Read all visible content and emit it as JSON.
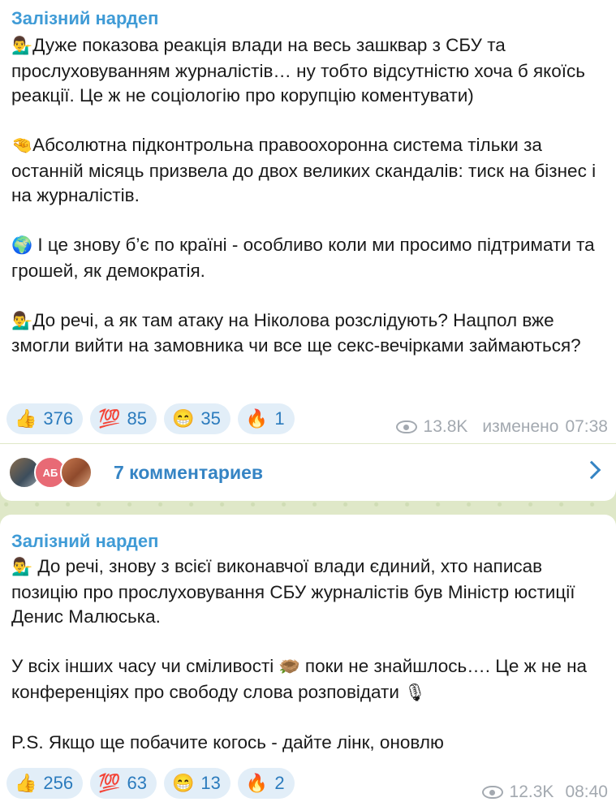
{
  "post1": {
    "sender": "Залізний нардеп",
    "paragraphs": [
      {
        "emoji": "💁‍♂️",
        "text": "Дуже показова реакція влади на весь зашквар з СБУ та прослуховуванням журналістів… ну тобто відсутністю хоча б якоїсь реакції. Це ж не соціологію про корупцію коментувати)"
      },
      {
        "emoji": "🤏",
        "text": "Абсолютна підконтрольна правоохоронна система тільки за останній місяць призвела до двох великих скандалів: тиск на бізнес і на журналістів."
      },
      {
        "emoji": "🌍",
        "text": " І це знову б’є по країні - особливо коли ми просимо підтримати та грошей, як демократія."
      },
      {
        "emoji": "💁‍♂️",
        "text": "До речі, а як там атаку на Ніколова розслідують? Нацпол вже змогли вийти на замовника чи все ще секс-вечірками займаються?"
      }
    ],
    "reactions": [
      {
        "icon": "👍",
        "count": "376"
      },
      {
        "icon": "💯",
        "count": "85"
      },
      {
        "icon": "😁",
        "count": "35"
      },
      {
        "icon": "🔥",
        "count": "1"
      }
    ],
    "views": "13.8K",
    "edited_label": "изменено",
    "time": "07:38"
  },
  "comments": {
    "avatar_initials": "АБ",
    "label": "7 комментариев"
  },
  "post2": {
    "sender": "Залізний нардеп",
    "p1_emoji": "💁‍♂️",
    "p1_text": "  До речі, знову з всієї виконавчої влади єдиний, хто написав позицію про прослуховування СБУ журналістів був Міністр юстиції Денис Малюська.",
    "p2_a": "У всіх інших часу чи сміливості ",
    "p2_emoji1": "🪹",
    "p2_b": "  поки не знайшлось…. Це ж не на конференціях про свободу слова розповідати ",
    "p2_emoji2": "🎙",
    "p3_text": "P.S. Якщо ще побачите когось - дайте лінк, оновлю",
    "reactions": [
      {
        "icon": "👍",
        "count": "256"
      },
      {
        "icon": "💯",
        "count": "63"
      },
      {
        "icon": "😁",
        "count": "13"
      },
      {
        "icon": "🔥",
        "count": "2"
      }
    ],
    "views": "12.3K",
    "time": "08:40"
  },
  "colors": {
    "accent": "#3f9bd6",
    "link": "#3584c4",
    "reaction_bg": "#e2eef8",
    "meta": "#a3a9b0",
    "wallpaper": "#dfe8c8"
  }
}
